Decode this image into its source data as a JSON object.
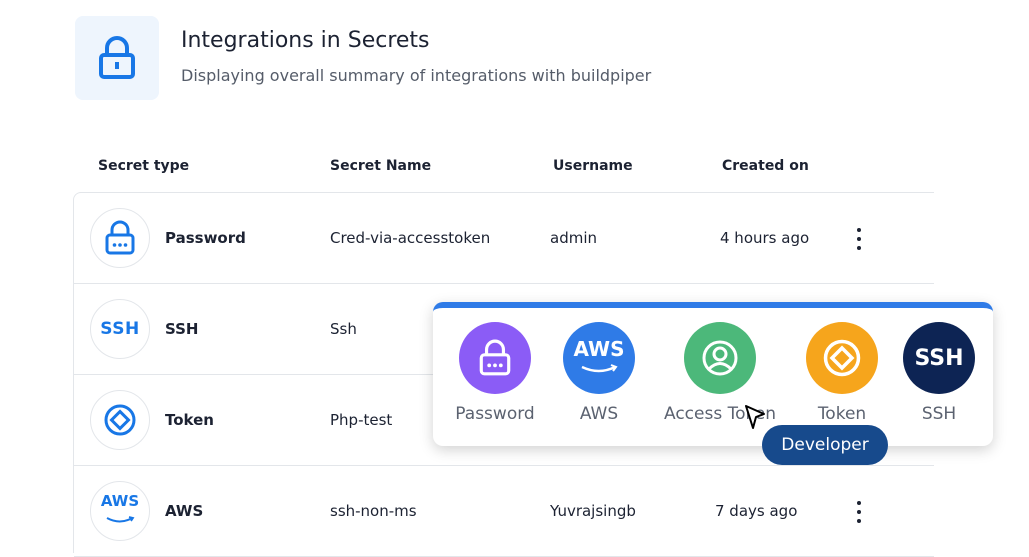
{
  "header": {
    "title": "Integrations in Secrets",
    "subtitle": "Displaying overall summary of integrations with buildpiper",
    "icon": "lock-icon"
  },
  "columns": [
    "Secret type",
    "Secret Name",
    "Username",
    "Created on"
  ],
  "rows": [
    {
      "type": "Password",
      "name": "Cred-via-accesstoken",
      "user": "admin",
      "created": "4 hours ago",
      "icon": "password-lock-icon"
    },
    {
      "type": "SSH",
      "name": "Ssh",
      "user": "",
      "created": "",
      "icon": "ssh-icon",
      "icon_text": "SSH"
    },
    {
      "type": "Token",
      "name": "Php-test",
      "user": "",
      "created": "",
      "icon": "token-icon"
    },
    {
      "type": "AWS",
      "name": "ssh-non-ms",
      "user": "Yuvrajsingb",
      "created": "7 days ago",
      "icon": "aws-icon",
      "icon_text": "AWS"
    }
  ],
  "popover": {
    "items": [
      {
        "label": "Password",
        "color": "#8b5cf6",
        "icon": "password-lock-icon"
      },
      {
        "label": "AWS",
        "color": "#2f7be7",
        "icon": "aws-icon",
        "icon_text": "AWS"
      },
      {
        "label": "Access Token",
        "color": "#4cb87a",
        "icon": "user-circle-icon"
      },
      {
        "label": "Token",
        "color": "#f6a51c",
        "icon": "token-icon"
      },
      {
        "label": "SSH",
        "color": "#0d2454",
        "icon": "ssh-icon",
        "icon_text": "SSH"
      }
    ],
    "accent": "#2f7be7"
  },
  "tooltip": {
    "label": "Developer",
    "color": "#174a8c"
  }
}
